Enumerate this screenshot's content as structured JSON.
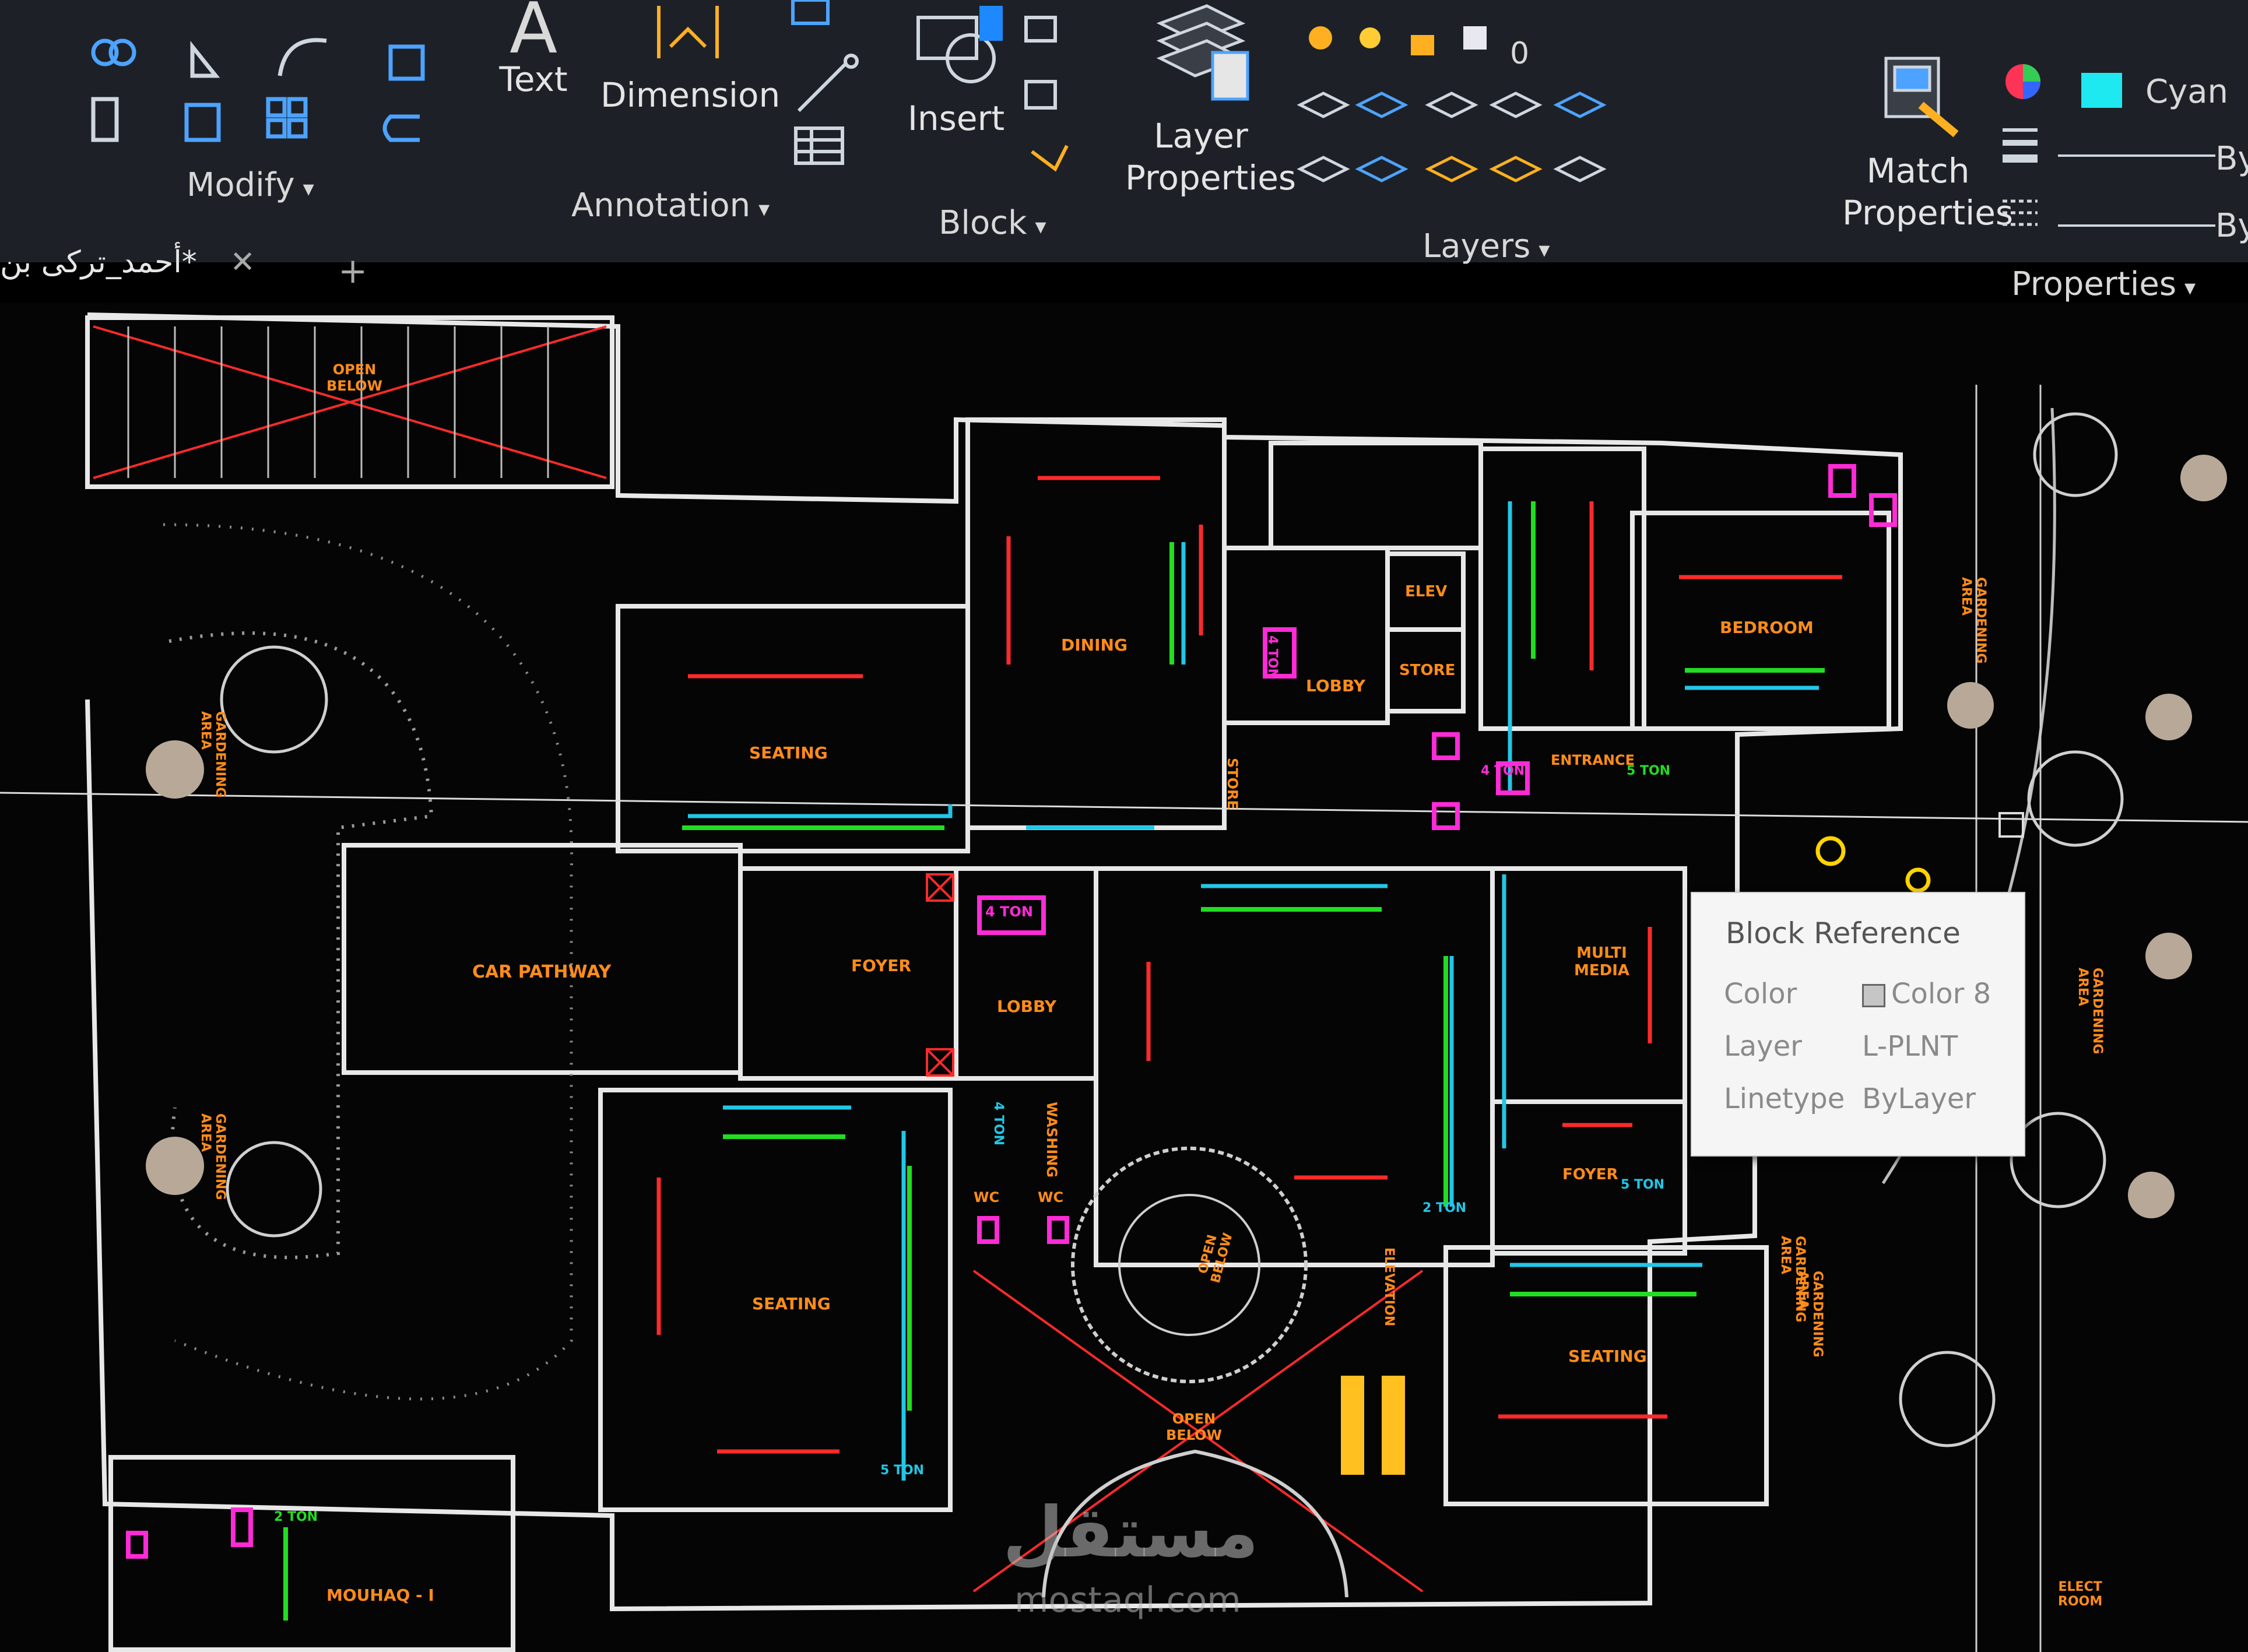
{
  "ribbon": {
    "modify": {
      "label": "Modify"
    },
    "annotation": {
      "label": "Annotation",
      "text_label": "Text",
      "dimension_label": "Dimension"
    },
    "block": {
      "label": "Block",
      "insert_label": "Insert"
    },
    "layers": {
      "label": "Layers",
      "layer_properties_label": "Layer\nProperties",
      "current_layer": "0"
    },
    "properties": {
      "label": "Properties",
      "match_properties_label": "Match\nProperties",
      "color_value": "Cyan",
      "lineweight_value": "By",
      "linetype_value": "By"
    },
    "caret": "▾"
  },
  "tabs": [
    {
      "label": "أحمد_تركى بن*",
      "close": "✕"
    }
  ],
  "new_tab": "+",
  "tooltip": {
    "title": "Block Reference",
    "rows": [
      {
        "key": "Color",
        "value": "Color 8"
      },
      {
        "key": "Layer",
        "value": "L-PLNT"
      },
      {
        "key": "Linetype",
        "value": "ByLayer"
      }
    ]
  },
  "rooms": {
    "dining": "DINING",
    "seating_top": "SEATING",
    "lobby": "LOBBY",
    "elev": "ELEV",
    "store": "STORE",
    "store_vertical": "STORE",
    "bedroom": "BEDROOM",
    "entrance": "ENTRANCE",
    "car_pathway": "CAR PATHWAY",
    "foyer_left": "FOYER",
    "lobby_center": "LOBBY",
    "multimedia": "MULTI\nMEDIA",
    "foyer_right": "FOYER",
    "seating_left": "SEATING",
    "seating_right": "SEATING",
    "washing": "WASHING",
    "wc1": "WC",
    "wc2": "WC",
    "moulhaq": "MOUHAQ - I",
    "open_below_top": "OPEN\nBELOW",
    "open_below_stair": "OPEN\nBELOW",
    "open_below_bottom": "OPEN\nBELOW",
    "gardening_1": "GARDENING\nAREA",
    "gardening_2": "GARDENING\nAREA",
    "gardening_3": "GARDENING\nAREA",
    "gardening_4": "GARDENING\nAREA",
    "gardening_5": "GARDENING\nAREA",
    "gardening_6": "GARDENING\nAREA",
    "elect_room": "ELECT\nROOM",
    "elevation": "ELEVATION"
  },
  "ac_units": {
    "u1": "4 TON",
    "u2": "4 TON",
    "u3": "5 TON",
    "u4": "4 TON",
    "u5": "5 TON",
    "u6": "2 TON",
    "u7": "5 TON",
    "u8": "2 TON",
    "u9": "4 TON"
  },
  "watermark": {
    "text": "مستقل",
    "url": "mostaql.com"
  },
  "colors": {
    "ribbon_bg": "#1d2127",
    "canvas_bg": "#050505",
    "wall": "#e8e8e8",
    "label": "#ff8c1a",
    "ac": "#00b4ff",
    "duct": "#22c6e6",
    "green": "#22dd22",
    "magenta": "#ff2bd6",
    "red": "#ff2a2a"
  }
}
